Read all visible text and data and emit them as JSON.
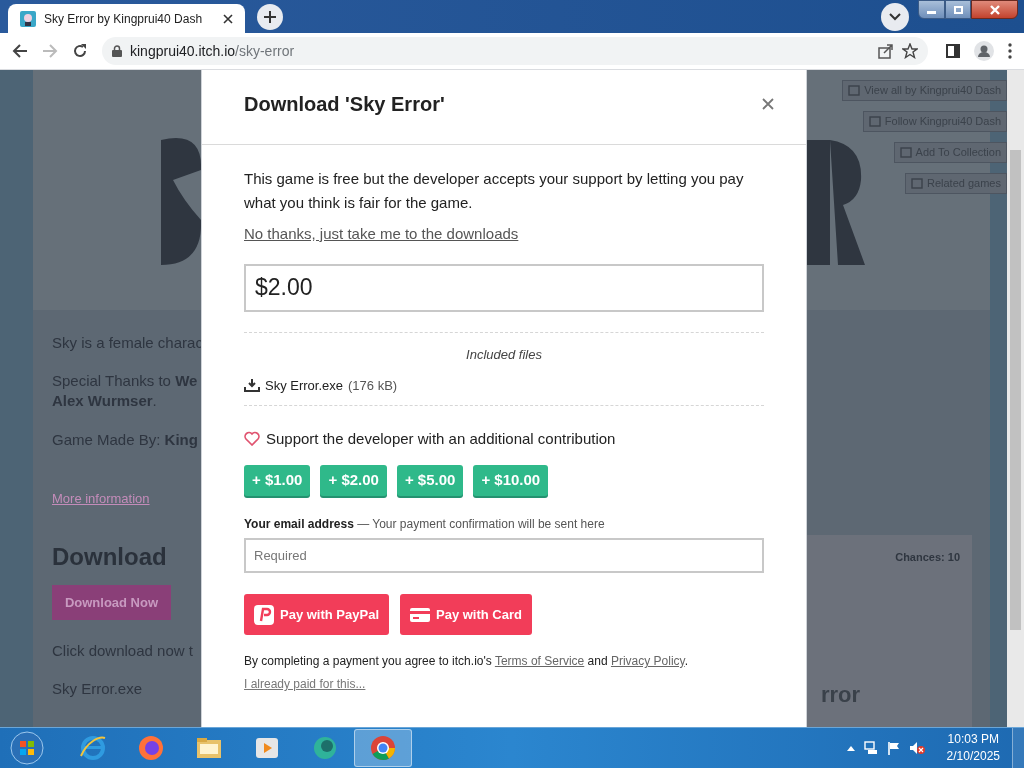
{
  "browser": {
    "tab": {
      "title": "Sky Error by Kingprui40 Dash",
      "selected": true
    },
    "url": {
      "host": "kingprui40.itch.io",
      "path": "/sky-error"
    }
  },
  "page": {
    "side_buttons": [
      "View all by Kingprui40 Dash",
      "Follow Kingprui40 Dash",
      "Add To Collection",
      "Related games"
    ],
    "description": [
      "Sky is a female charac",
      "Special Thanks to **We**",
      "**Alex Wurmser**.",
      "Game Made By: **King**"
    ],
    "more_info": "More information",
    "download_heading": "Download",
    "download_button": "Download Now",
    "click_text": "Click download now t",
    "file_name": "Sky Error.exe",
    "card": {
      "chances": "Chances: 10",
      "title_fragment": "rror"
    }
  },
  "modal": {
    "title": "Download 'Sky Error'",
    "intro": "This game is free but the developer accepts your support by letting you pay what you think is fair for the game.",
    "skip_link": "No thanks, just take me to the downloads",
    "price": "$2.00",
    "included_label": "Included files",
    "files": [
      {
        "name": "Sky Error.exe",
        "size": "(176 kB)"
      }
    ],
    "support_text": "Support the developer with an additional contribution",
    "tips": [
      "+ $1.00",
      "+ $2.00",
      "+ $5.00",
      "+ $10.00"
    ],
    "email_label": "Your email address",
    "email_hint": "— Your payment confirmation will be sent here",
    "email_placeholder": "Required",
    "pay_buttons": [
      {
        "kind": "paypal",
        "label": "Pay with PayPal"
      },
      {
        "kind": "card",
        "label": "Pay with Card"
      }
    ],
    "terms": {
      "before": "By completing a payment you agree to itch.io's",
      "terms_link": "Terms of Service",
      "middle": "and",
      "privacy_link": "Privacy Policy",
      "after": "."
    },
    "already_paid": "I already paid for this..."
  },
  "taskbar": {
    "apps": [
      {
        "kind": "ie",
        "selected": false
      },
      {
        "kind": "firefox",
        "selected": false
      },
      {
        "kind": "folder",
        "selected": false
      },
      {
        "kind": "media",
        "selected": false
      },
      {
        "kind": "chat",
        "selected": false
      },
      {
        "kind": "chrome",
        "selected": true
      }
    ],
    "time": "10:03 PM",
    "date": "2/10/2025"
  }
}
